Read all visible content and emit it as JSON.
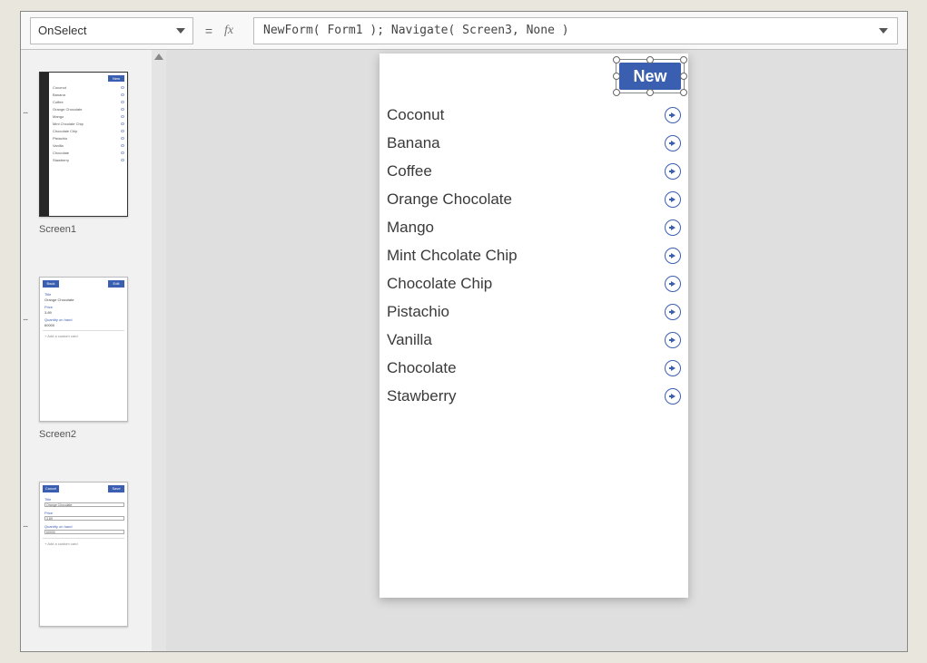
{
  "formula_bar": {
    "property": "OnSelect",
    "fx_label": "fx",
    "equals": "=",
    "formula": "NewForm( Form1 ); Navigate( Screen3, None )"
  },
  "thumbnails": {
    "screen1_label": "Screen1",
    "screen2_label": "Screen2",
    "t1_new": "New",
    "t1_items": [
      "Coconut",
      "Banana",
      "Coffee",
      "Orange Chocolate",
      "Mango",
      "Mint Chcolate Chip",
      "Chocolate Chip",
      "Pistachio",
      "Vanilla",
      "Chocolate",
      "Stawberry"
    ],
    "t2_back": "Back",
    "t2_edit": "Edit",
    "t2_title_lbl": "Title",
    "t2_title_val": "Orange Chocolate",
    "t2_price_lbl": "Price",
    "t2_price_val": "3.89",
    "t2_qty_lbl": "Quantity on hand",
    "t2_qty_val": "60000",
    "add_card": "+  Add a custom card",
    "t3_cancel": "Cancel",
    "t3_save": "Save",
    "t3_title_lbl": "Title",
    "t3_title_val": "Orange Chocolate",
    "t3_price_lbl": "Price",
    "t3_price_val": "3.89",
    "t3_qty_lbl": "Quantity on hand",
    "t3_qty_val": "60000"
  },
  "canvas": {
    "new_button": "New",
    "items": [
      "Coconut",
      "Banana",
      "Coffee",
      "Orange Chocolate",
      "Mango",
      "Mint Chcolate Chip",
      "Chocolate Chip",
      "Pistachio",
      "Vanilla",
      "Chocolate",
      "Stawberry"
    ]
  }
}
